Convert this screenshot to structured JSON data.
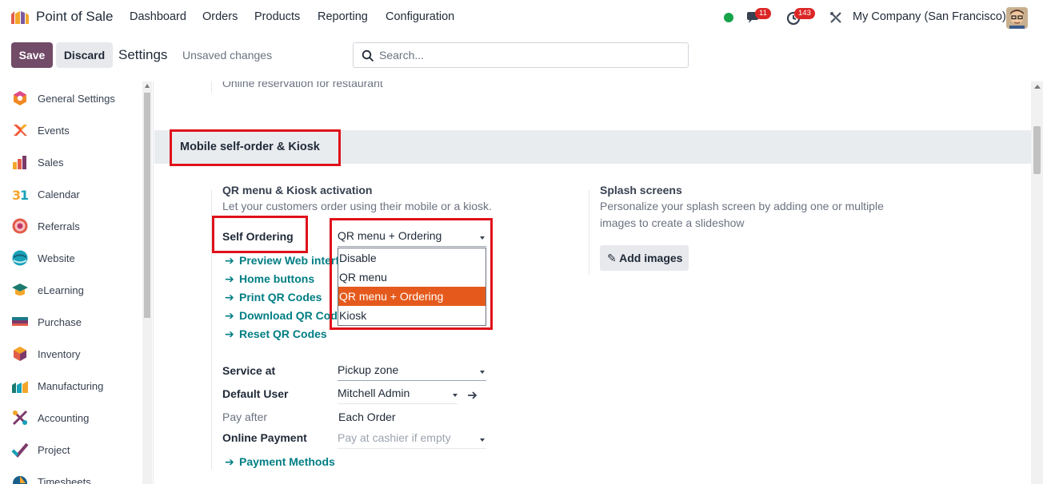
{
  "app": {
    "name": "Point of Sale"
  },
  "menu": [
    "Dashboard",
    "Orders",
    "Products",
    "Reporting",
    "Configuration"
  ],
  "nav": {
    "messages_count": "11",
    "activities_count": "143",
    "company": "My Company (San Francisco)"
  },
  "control": {
    "save_label": "Save",
    "discard_label": "Discard",
    "page_title": "Settings",
    "status": "Unsaved changes",
    "search_placeholder": "Search..."
  },
  "sidebar": {
    "items": [
      {
        "label": "General Settings",
        "icon": "general-settings-icon"
      },
      {
        "label": "Events",
        "icon": "events-icon"
      },
      {
        "label": "Sales",
        "icon": "sales-icon"
      },
      {
        "label": "Calendar",
        "icon": "calendar-icon"
      },
      {
        "label": "Referrals",
        "icon": "referrals-icon"
      },
      {
        "label": "Website",
        "icon": "website-icon"
      },
      {
        "label": "eLearning",
        "icon": "elearning-icon"
      },
      {
        "label": "Purchase",
        "icon": "purchase-icon"
      },
      {
        "label": "Inventory",
        "icon": "inventory-icon"
      },
      {
        "label": "Manufacturing",
        "icon": "manufacturing-icon"
      },
      {
        "label": "Accounting",
        "icon": "accounting-icon"
      },
      {
        "label": "Project",
        "icon": "project-icon"
      },
      {
        "label": "Timesheets",
        "icon": "timesheets-icon"
      }
    ]
  },
  "main": {
    "previous_setting_desc": "Online reservation for restaurant",
    "section_title": "Mobile self-order & Kiosk",
    "qr": {
      "title": "QR menu & Kiosk activation",
      "description": "Let your customers order using their mobile or a kiosk.",
      "self_ordering_label": "Self Ordering",
      "self_ordering_value": "QR menu + Ordering",
      "dropdown_options": [
        "Disable",
        "QR menu",
        "QR menu + Ordering",
        "Kiosk"
      ],
      "dropdown_selected": "QR menu + Ordering",
      "links": [
        "Preview Web interface",
        "Home buttons",
        "Print QR Codes",
        "Download QR Codes",
        "Reset QR Codes"
      ],
      "service_at_label": "Service at",
      "service_at_value": "Pickup zone",
      "default_user_label": "Default User",
      "default_user_value": "Mitchell Admin",
      "pay_after_label": "Pay after",
      "pay_after_value": "Each Order",
      "online_payment_label": "Online Payment",
      "online_payment_placeholder": "Pay at cashier if empty",
      "payment_methods_link": "Payment Methods"
    },
    "splash": {
      "title": "Splash screens",
      "description_line1": "Personalize your splash screen by adding one or multiple",
      "description_line2": "images to create a slideshow",
      "add_images_label": "Add images"
    }
  },
  "colors": {
    "brand": "#714b67",
    "link": "#017e84",
    "highlight": "#e0101a",
    "selected_option": "#e55a1c"
  }
}
